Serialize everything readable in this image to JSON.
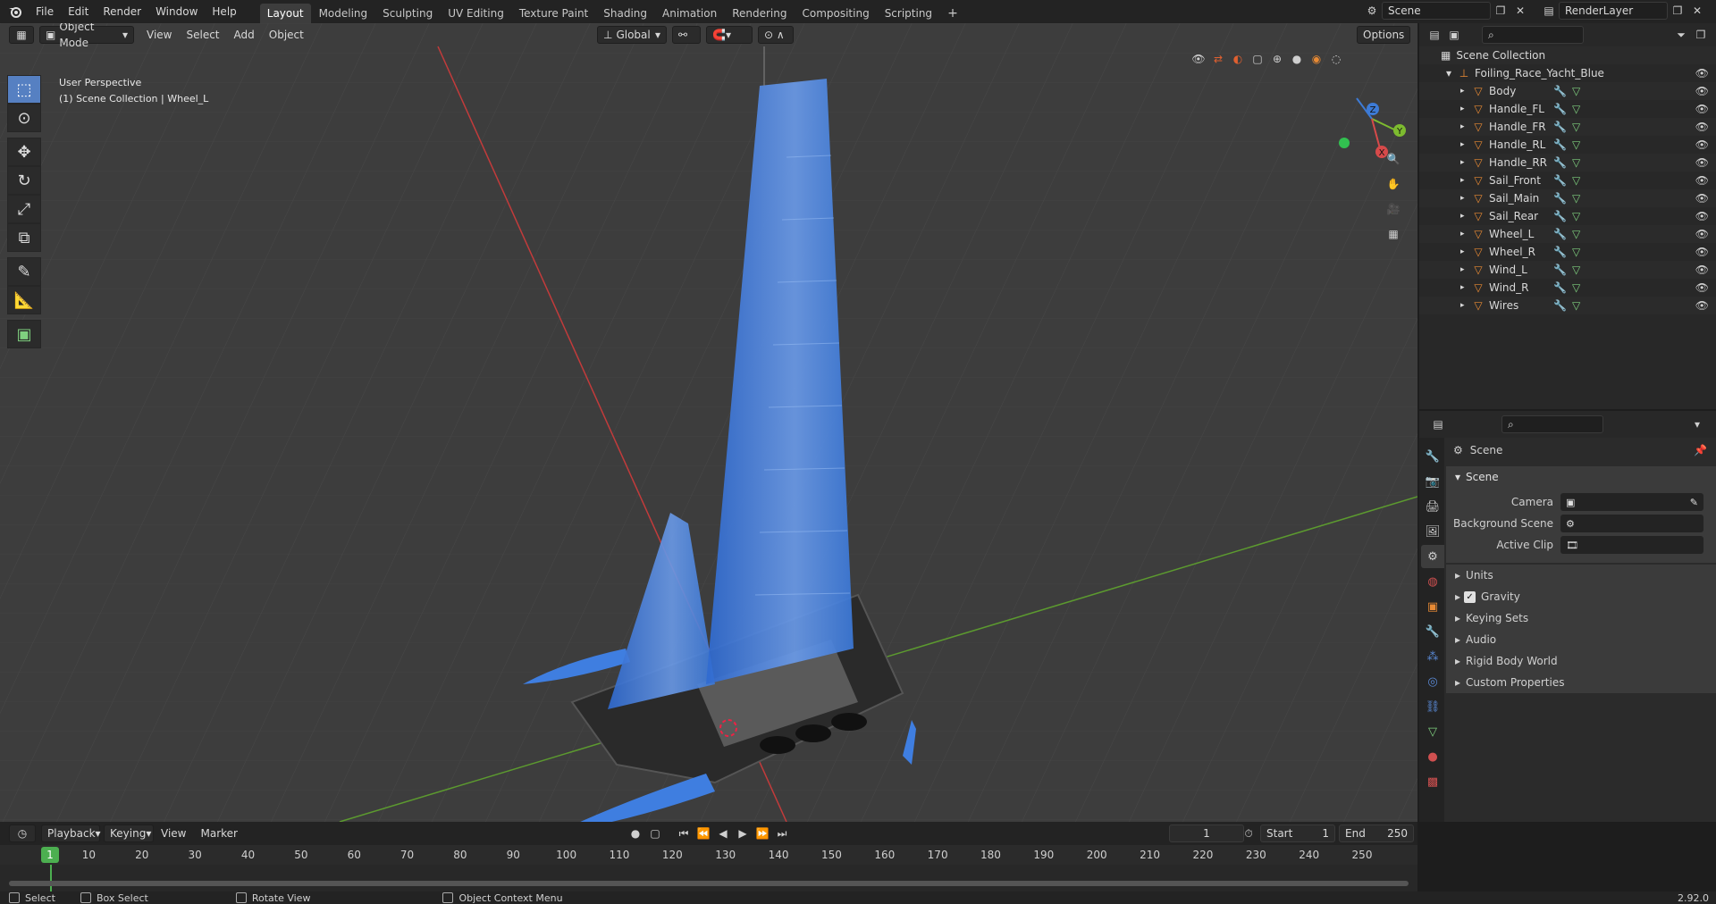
{
  "topbar": {
    "menus": [
      "File",
      "Edit",
      "Render",
      "Window",
      "Help"
    ],
    "workspaces": [
      "Layout",
      "Modeling",
      "Sculpting",
      "UV Editing",
      "Texture Paint",
      "Shading",
      "Animation",
      "Rendering",
      "Compositing",
      "Scripting"
    ],
    "active_workspace": "Layout",
    "add_tab": "+",
    "scene_name": "Scene",
    "view_layer": "RenderLayer"
  },
  "viewport": {
    "mode": "Object Mode",
    "menus": [
      "View",
      "Select",
      "Add",
      "Object"
    ],
    "transform_orientation": "Global",
    "options_label": "Options",
    "overlay_line1": "User Perspective",
    "overlay_line2": "(1) Scene Collection | Wheel_L",
    "gizmo": {
      "x": "X",
      "y": "Y",
      "z": "Z"
    }
  },
  "outliner": {
    "root": "Scene Collection",
    "collection": "Foiling_Race_Yacht_Blue",
    "items": [
      "Body",
      "Handle_FL",
      "Handle_FR",
      "Handle_RL",
      "Handle_RR",
      "Sail_Front",
      "Sail_Main",
      "Sail_Rear",
      "Wheel_L",
      "Wheel_R",
      "Wind_L",
      "Wind_R",
      "Wires"
    ],
    "selected": "Wheel_L"
  },
  "properties": {
    "context": "Scene",
    "panel": "Scene",
    "fields": [
      {
        "label": "Camera",
        "value": ""
      },
      {
        "label": "Background Scene",
        "value": ""
      },
      {
        "label": "Active Clip",
        "value": ""
      }
    ],
    "subpanels": [
      "Units",
      "Gravity",
      "Keying Sets",
      "Audio",
      "Rigid Body World",
      "Custom Properties"
    ],
    "gravity_enabled": true
  },
  "timeline": {
    "menus": [
      "Playback",
      "Keying",
      "View",
      "Marker"
    ],
    "current_frame": "1",
    "start_label": "Start",
    "start": "1",
    "end_label": "End",
    "end": "250",
    "ticks": [
      "10",
      "20",
      "30",
      "40",
      "50",
      "60",
      "70",
      "80",
      "90",
      "100",
      "110",
      "120",
      "130",
      "140",
      "150",
      "160",
      "170",
      "180",
      "190",
      "200",
      "210",
      "220",
      "230",
      "240",
      "250"
    ],
    "playhead": "1"
  },
  "statusbar": {
    "items": [
      "Select",
      "Box Select",
      "Rotate View",
      "Object Context Menu"
    ],
    "version": "2.92.0"
  },
  "colors": {
    "accent": "#5680c2",
    "object_orange": "#e88a34",
    "axis_x": "#c23b3b",
    "axis_y": "#5c9a2f",
    "sail_blue": "#3f7ee0"
  }
}
